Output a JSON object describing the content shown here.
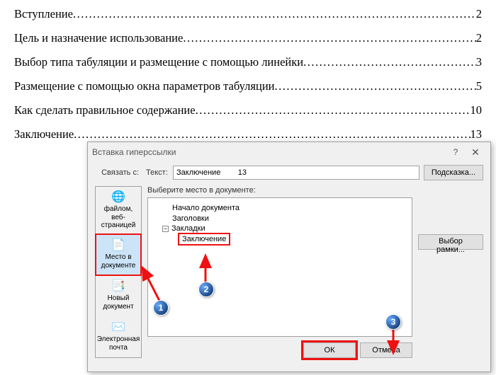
{
  "toc": {
    "items": [
      {
        "title": "Вступление",
        "page": "2"
      },
      {
        "title": "Цель и назначение использование",
        "page": "2"
      },
      {
        "title": "Выбор типа табуляции и размещение с помощью линейки",
        "page": "3"
      },
      {
        "title": "Размещение с помощью окна параметров табуляции",
        "page": "5"
      },
      {
        "title": "Как сделать правильное содержание",
        "page": "10"
      },
      {
        "title": "Заключение",
        "page": "13"
      }
    ]
  },
  "dialog": {
    "title": "Вставка гиперссылки",
    "link_to_label": "Связать с:",
    "text_label": "Текст:",
    "text_value": "Заключение        13",
    "tip_button": "Подсказка...",
    "choose_label": "Выберите место в документе:",
    "frame_button": "Выбор рамки...",
    "ok_button": "ОК",
    "cancel_button": "Отмена",
    "sidebar": {
      "items": [
        "файлом, веб-страницей",
        "Место в документе",
        "Новый документ",
        "Электронная почта"
      ]
    },
    "tree": {
      "top": "Начало документа",
      "headings": "Заголовки",
      "bookmarks": "Закладки",
      "bookmark_item": "Заключение"
    }
  },
  "callouts": {
    "c1": "1",
    "c2": "2",
    "c3": "3"
  }
}
